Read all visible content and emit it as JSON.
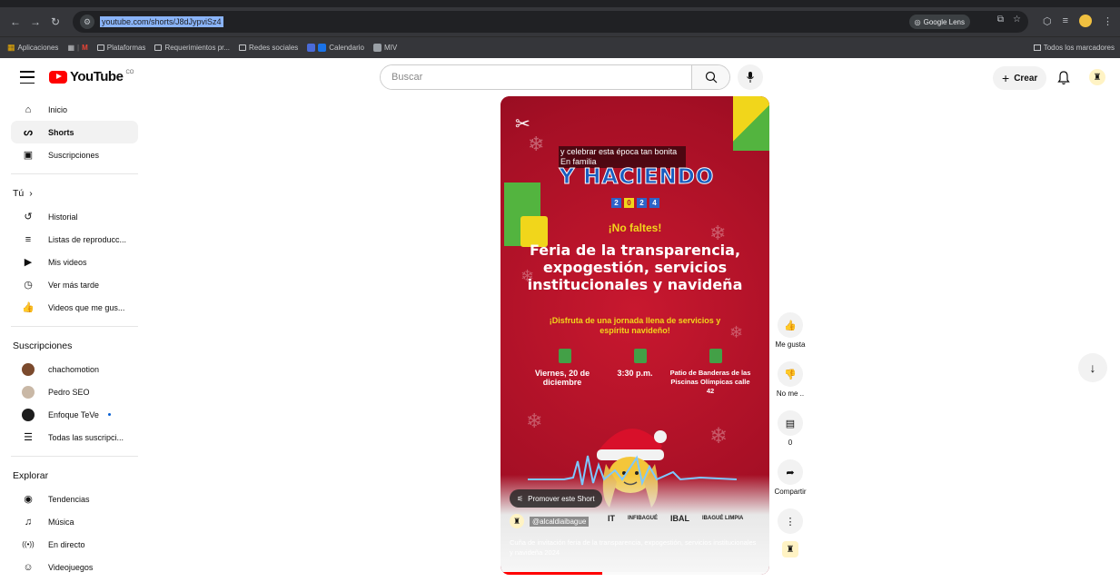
{
  "browser": {
    "url": "youtube.com/shorts/J8dJypviSz4",
    "lens_label": "Google Lens",
    "bookmarks": [
      {
        "label": "Aplicaciones"
      },
      {
        "label": "Plataformas"
      },
      {
        "label": "Requerimientos pr..."
      },
      {
        "label": "Redes sociales"
      },
      {
        "label": "Calendario"
      },
      {
        "label": "MIV"
      }
    ],
    "all_bookmarks": "Todos los marcadores"
  },
  "header": {
    "logo_text": "YouTube",
    "country_code": "CO",
    "search_placeholder": "Buscar",
    "create_label": "Crear"
  },
  "sidebar": {
    "main": [
      {
        "label": "Inicio",
        "icon": "home-icon"
      },
      {
        "label": "Shorts",
        "icon": "shorts-icon"
      },
      {
        "label": "Suscripciones",
        "icon": "subscriptions-icon"
      }
    ],
    "you_heading": "Tú",
    "you": [
      {
        "label": "Historial",
        "icon": "history-icon"
      },
      {
        "label": "Listas de reproducc...",
        "icon": "playlist-icon"
      },
      {
        "label": "Mis videos",
        "icon": "my-videos-icon"
      },
      {
        "label": "Ver más tarde",
        "icon": "watch-later-icon"
      },
      {
        "label": "Videos que me gus...",
        "icon": "liked-icon"
      }
    ],
    "subs_heading": "Suscripciones",
    "subs": [
      {
        "label": "chachomotion",
        "color": "#7b4a2d"
      },
      {
        "label": "Pedro SEO",
        "color": "#c9b8a6"
      },
      {
        "label": "Enfoque TeVe",
        "color": "#1d1d1d"
      },
      {
        "label": "Todas las suscripci..."
      }
    ],
    "explore_heading": "Explorar",
    "explore": [
      {
        "label": "Tendencias",
        "icon": "trending-icon"
      },
      {
        "label": "Música",
        "icon": "music-icon"
      },
      {
        "label": "En directo",
        "icon": "live-icon"
      },
      {
        "label": "Videojuegos",
        "icon": "gaming-icon"
      }
    ]
  },
  "short": {
    "overlay_caption": "y celebrar esta época tan bonita En familia",
    "headline": "Y HACIENDO",
    "year_digits": [
      "2",
      "0",
      "2",
      "4"
    ],
    "no_faltes": "¡No faltes!",
    "title": "Feria de la transparencia, expogestión, servicios institucionales y navideña",
    "subtitle": "¡Disfruta de una jornada llena de servicios y espíritu navideño!",
    "date": "Viernes, 20 de diciembre",
    "time": "3:30 p.m.",
    "place": "Patio de Banderas de las Piscinas Olímpicas calle 42",
    "promote_label": "Promover este Short",
    "channel": "@alcaldiaibague",
    "sponsor_logos": [
      "IT",
      "INFIBAGUÉ",
      "IBAL",
      "IBAGUÉ LIMPIA"
    ],
    "description": "Cuña de invitación feria de la transparencia, expogestión, servicios institucionales y navideña 2024",
    "progress": 0.38
  },
  "actions": {
    "like_label": "Me gusta",
    "dislike_label": "No me ..",
    "comments_count": "0",
    "share_label": "Compartir"
  },
  "colors": {
    "youtube_red": "#ff0000",
    "poster_red": "#b3122a",
    "poster_yellow": "#f1d61b",
    "poster_blue": "#1a5dbf"
  }
}
